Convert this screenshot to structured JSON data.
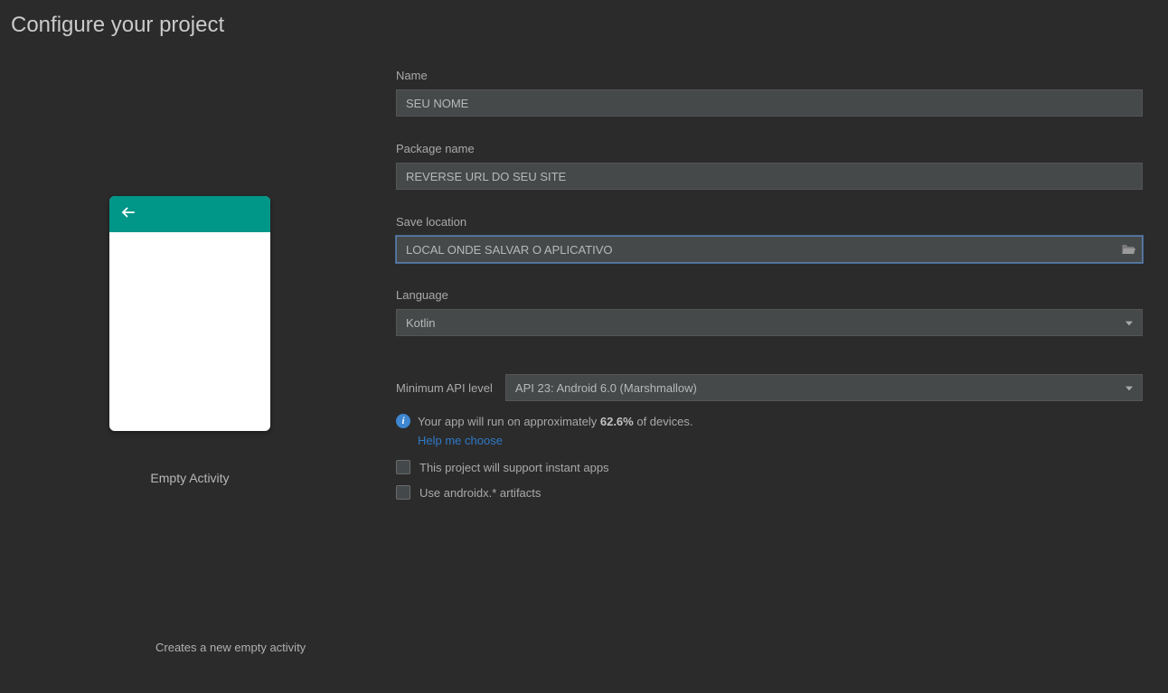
{
  "page_title": "Configure your project",
  "preview": {
    "template_name": "Empty Activity",
    "template_description": "Creates a new empty activity"
  },
  "form": {
    "name": {
      "label": "Name",
      "value": "SEU NOME"
    },
    "package_name": {
      "label": "Package name",
      "value": "REVERSE URL DO SEU SITE"
    },
    "save_location": {
      "label": "Save location",
      "value": "LOCAL ONDE SALVAR O APLICATIVO"
    },
    "language": {
      "label": "Language",
      "value": "Kotlin"
    },
    "min_api": {
      "label": "Minimum API level",
      "value": "API 23: Android 6.0 (Marshmallow)"
    },
    "info": {
      "prefix": "Your app will run on approximately ",
      "percent": "62.6%",
      "suffix": " of devices."
    },
    "help_link": "Help me choose",
    "instant_apps_label": "This project will support instant apps",
    "androidx_label": "Use androidx.* artifacts"
  }
}
